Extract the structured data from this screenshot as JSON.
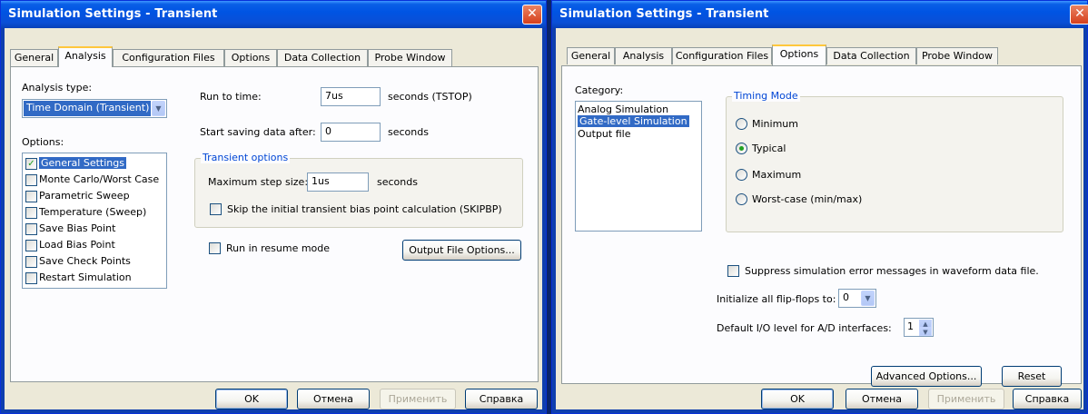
{
  "left": {
    "title": "Simulation Settings - Transient",
    "tabs": [
      "General",
      "Analysis",
      "Configuration Files",
      "Options",
      "Data Collection",
      "Probe Window"
    ],
    "active_tab": "Analysis",
    "analysis_type_label": "Analysis type:",
    "analysis_type_value": "Time Domain (Transient)",
    "options_label": "Options:",
    "options": [
      {
        "label": "General Settings",
        "checked": true,
        "selected": true
      },
      {
        "label": "Monte Carlo/Worst Case",
        "checked": false
      },
      {
        "label": "Parametric Sweep",
        "checked": false
      },
      {
        "label": "Temperature (Sweep)",
        "checked": false
      },
      {
        "label": "Save Bias Point",
        "checked": false
      },
      {
        "label": "Load Bias Point",
        "checked": false
      },
      {
        "label": "Save Check Points",
        "checked": false
      },
      {
        "label": "Restart Simulation",
        "checked": false
      }
    ],
    "run_to_time_label": "Run to time:",
    "run_to_time_value": "7us",
    "run_to_time_unit": "seconds  (TSTOP)",
    "start_saving_label": "Start saving data after:",
    "start_saving_value": "0",
    "start_saving_unit": "seconds",
    "transient_group": "Transient options",
    "max_step_label": "Maximum step size:",
    "max_step_value": "1us",
    "max_step_unit": "seconds",
    "skip_bias_label": "Skip the initial transient bias point calculation  (SKIPBP)",
    "resume_label": "Run in resume mode",
    "output_file_options": "Output File Options...",
    "buttons": {
      "ok": "OK",
      "cancel": "Отмена",
      "apply": "Применить",
      "help": "Справка"
    }
  },
  "right": {
    "title": "Simulation Settings - Transient",
    "tabs": [
      "General",
      "Analysis",
      "Configuration Files",
      "Options",
      "Data Collection",
      "Probe Window"
    ],
    "active_tab": "Options",
    "category_label": "Category:",
    "categories": [
      {
        "label": "Analog Simulation",
        "selected": false
      },
      {
        "label": "Gate-level Simulation",
        "selected": true
      },
      {
        "label": "Output file",
        "selected": false
      }
    ],
    "timing_mode_group": "Timing Mode",
    "timing_modes": [
      {
        "label": "Minimum",
        "selected": false
      },
      {
        "label": "Typical",
        "selected": true
      },
      {
        "label": "Maximum",
        "selected": false
      },
      {
        "label": "Worst-case (min/max)",
        "selected": false
      }
    ],
    "suppress_label": "Suppress simulation error messages in waveform data file.",
    "init_ff_label": "Initialize all flip-flops to:",
    "init_ff_value": "0",
    "default_io_label": "Default I/O level for A/D interfaces:",
    "default_io_value": "1",
    "advanced_options": "Advanced Options...",
    "reset": "Reset",
    "buttons": {
      "ok": "OK",
      "cancel": "Отмена",
      "apply": "Применить",
      "help": "Справка"
    }
  },
  "colors": {
    "titlebar": "#0054e3",
    "selection": "#316ac5",
    "group_title": "#0046d5",
    "dialog_bg": "#ece9d8"
  }
}
